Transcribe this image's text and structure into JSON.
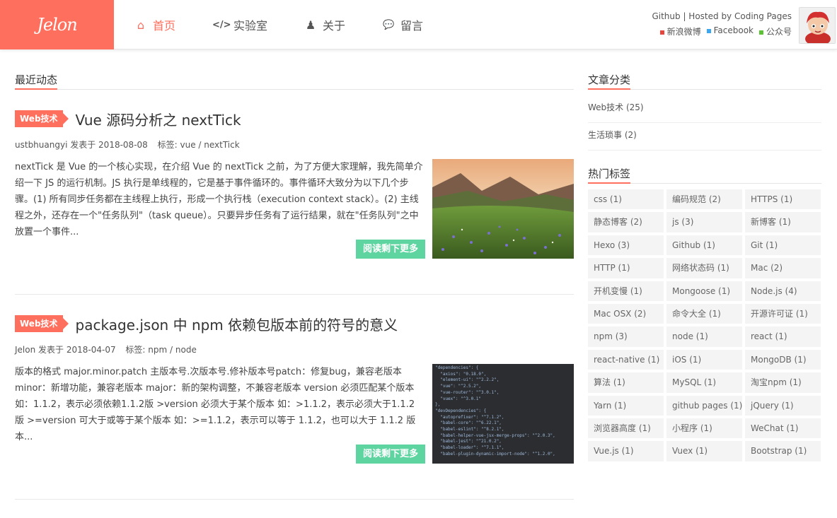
{
  "header": {
    "logo": "Jelon",
    "nav": [
      {
        "label": "首页",
        "icon": "home-icon",
        "glyph": "⌂",
        "active": true
      },
      {
        "label": "实验室",
        "icon": "code-icon",
        "glyph": "</>",
        "active": false
      },
      {
        "label": "关于",
        "icon": "user-icon",
        "glyph": "♟",
        "active": false
      },
      {
        "label": "留言",
        "icon": "comments-icon",
        "glyph": "💬",
        "active": false
      }
    ],
    "hosted": "Github | Hosted by Coding Pages",
    "social": [
      {
        "label": "新浪微博",
        "color": "#e8453c"
      },
      {
        "label": "Facebook",
        "color": "#3aa7f0"
      },
      {
        "label": "公众号",
        "color": "#5bc235"
      }
    ]
  },
  "main": {
    "section_title": "最近动态",
    "posts": [
      {
        "category": "Web技术",
        "title": "Vue 源码分析之 nextTick",
        "author": "ustbhuangyi",
        "published": "发表于 2018-08-08",
        "tags_label": "标签:",
        "tags": "vue / nextTick",
        "excerpt": "nextTick 是 Vue 的一个核心实现，在介绍 Vue 的 nextTick 之前，为了方便大家理解，我先简单介绍一下 JS 的运行机制。JS 执行是单线程的，它是基于事件循环的。事件循环大致分为以下几个步骤。(1) 所有同步任务都在主线程上执行，形成一个执行栈（execution context stack）。(2) 主线程之外，还存在一个\"任务队列\"（task queue）。只要异步任务有了运行结果，就在\"任务队列\"之中放置一个事件...",
        "read_more": "阅读剩下更多"
      },
      {
        "category": "Web技术",
        "title": "package.json 中 npm 依赖包版本前的符号的意义",
        "author": "Jelon",
        "published": "发表于 2018-04-07",
        "tags_label": "标签:",
        "tags": "npm / node",
        "excerpt": "版本的格式 major.minor.patch 主版本号.次版本号.修补版本号patch：修复bug，兼容老版本 minor：新增功能，兼容老版本 major：新的架构调整，不兼容老版本 version 必须匹配某个版本 如：1.1.2，表示必须依赖1.1.2版 >version 必须大于某个版本 如：>1.1.2，表示必须大于1.1.2 版 >=version 可大于或等于某个版本 如：>=1.1.2，表示可以等于 1.1.2，也可以大于 1.1.2 版本...",
        "read_more": "阅读剩下更多",
        "code_lines": [
          "\"dependencies\": {",
          "  \"axios\": \"0.18.0\",",
          "  \"element-ui\": \"^2.2.2\",",
          "  \"vue\": \"^2.5.2\",",
          "  \"vue-router\": \"^3.0.1\",",
          "  \"vuex\": \"^3.0.1\"",
          "},",
          "\"devDependencies\": {",
          "  \"autoprefixer\": \"^7.1.2\",",
          "  \"babel-core\": \"^6.22.1\",",
          "  \"babel-eslint\": \"^8.2.1\",",
          "  \"babel-helper-vue-jsx-merge-props\": \"^2.0.3\",",
          "  \"babel-jest\": \"^21.0.2\",",
          "  \"babel-loader\": \"^7.1.1\",",
          "  \"babel-plugin-dynamic-import-node\": \"^1.2.0\","
        ]
      }
    ]
  },
  "sidebar": {
    "categories_title": "文章分类",
    "categories": [
      "Web技术 (25)",
      "生活琐事 (2)"
    ],
    "tags_title": "热门标签",
    "tags": [
      "css (1)",
      "编码规范 (2)",
      "HTTPS (1)",
      "静态博客 (2)",
      "js (3)",
      "新博客 (1)",
      "Hexo (3)",
      "Github (1)",
      "Git (1)",
      "HTTP (1)",
      "网络状态码 (1)",
      "Mac (2)",
      "开机变慢 (1)",
      "Mongoose (1)",
      "Node.js (4)",
      "Mac OSX (2)",
      "命令大全 (1)",
      "开源许可证 (1)",
      "npm (3)",
      "node (1)",
      "react (1)",
      "react-native (1)",
      "iOS (1)",
      "MongoDB (1)",
      "算法 (1)",
      "MySQL (1)",
      "淘宝npm (1)",
      "Yarn (1)",
      "github pages (1)",
      "jQuery (1)",
      "浏览器高度 (1)",
      "小程序 (1)",
      "WeChat (1)",
      "Vue.js (1)",
      "Vuex (1)",
      "Bootstrap (1)"
    ]
  }
}
